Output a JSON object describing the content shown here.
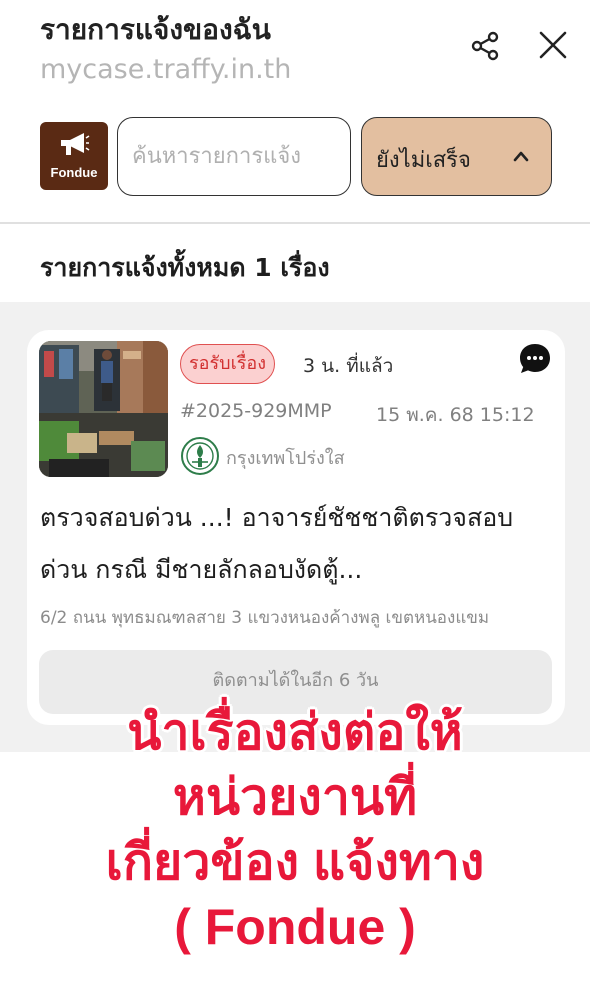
{
  "header": {
    "title": "รายการแจ้งของฉัน",
    "url": "mycase.traffy.in.th",
    "share_icon": "share-icon",
    "close_icon": "close-icon"
  },
  "toolbar": {
    "logo_label": "Fondue",
    "search_placeholder": "ค้นหารายการแจ้ง",
    "search_value": "",
    "filter_label": "ยังไม่เสร็จ",
    "filter_icon": "chevron-up-icon"
  },
  "summary": {
    "count_text": "รายการแจ้งทั้งหมด 1 เรื่อง"
  },
  "cases": [
    {
      "status": "รอรับเรื่อง",
      "time_ago": "3 น. ที่แล้ว",
      "case_id": "#2025-929MMP",
      "date": "15 พ.ค. 68 15:12",
      "agency": "กรุงเทพโปร่งใส",
      "description": "ตรวจสอบด่วน ...! อาจารย์ชัชชาติตรวจสอบด่วน กรณี มีชายลักลอบงัดตู้...",
      "address": "6/2 ถนน พุทธมณฑลสาย 3 แขวงหนองค้างพลู เขตหนองแขม",
      "follow_text": "ติดตามได้ในอีก 6 วัน",
      "status_color": "#d23030"
    }
  ],
  "overlay_text": {
    "line1": "นำเรื่องส่งต่อให้",
    "line2": "หน่วยงานที่",
    "line3": "เกี่ยวข้อง แจ้งทาง",
    "line4": "( Fondue )"
  },
  "colors": {
    "brand": "#5a2a14",
    "filter_bg": "#e3bfa0",
    "overlay_text": "#e8183a"
  }
}
